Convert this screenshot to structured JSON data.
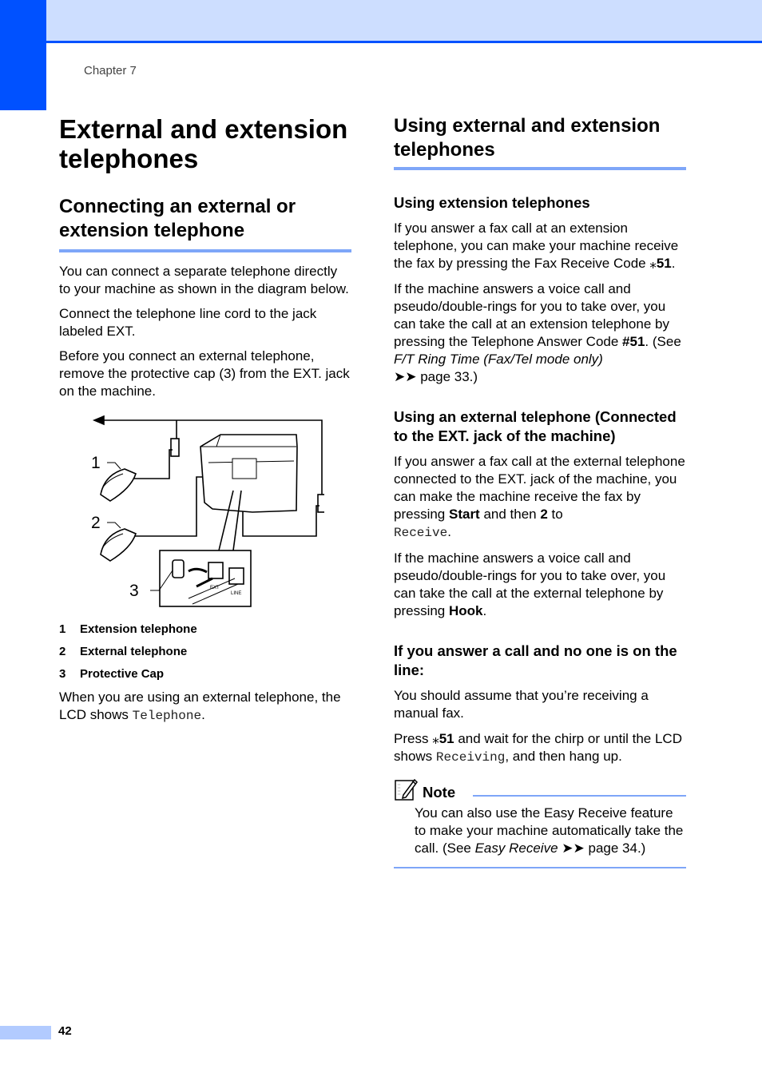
{
  "header": {
    "chapter_label": "Chapter 7"
  },
  "left": {
    "title": "External and extension telephones",
    "section_heading": "Connecting an external or extension telephone",
    "paragraphs": [
      "You can connect a separate telephone directly to your machine as shown in the diagram below.",
      "Connect the telephone line cord to the jack labeled EXT.",
      "Before you connect an external telephone, remove the protective cap (3) from the EXT. jack on the machine."
    ],
    "figure": {
      "callouts": [
        "1",
        "2",
        "3"
      ],
      "jack_labels": [
        "EXT",
        "LINE"
      ]
    },
    "legend": [
      {
        "num": "1",
        "label": "Extension telephone"
      },
      {
        "num": "2",
        "label": "External telephone"
      },
      {
        "num": "3",
        "label": "Protective Cap"
      }
    ],
    "lcd_para": {
      "pre": "When you are using an external telephone, the LCD shows ",
      "mono": "Telephone",
      "post": "."
    }
  },
  "right": {
    "section_heading": "Using external and extension telephones",
    "sub1": {
      "heading": "Using extension telephones",
      "p1": {
        "pre": "If you answer a fax call at an extension telephone, you can make your machine receive the fax by pressing the Fax Receive Code ",
        "star": "⁎",
        "bold": "51",
        "post": "."
      },
      "p2": {
        "pre": "If the machine answers a voice call and pseudo/double-rings for you to take over, you can take the call at an extension telephone by pressing the Telephone Answer Code ",
        "bold": "#51",
        "mid": ". (See ",
        "italic": "F/T Ring Time (Fax/Tel mode only)",
        "arrows": "➤➤",
        "post": " page 33.)"
      }
    },
    "sub2": {
      "heading": "Using an external telephone (Connected to the EXT. jack of the machine)",
      "p1": {
        "pre": "If you answer a fax call at the external telephone connected to the EXT. jack of the machine, you can make the machine receive the fax by pressing ",
        "bold1": "Start",
        "mid": " and then ",
        "bold2": "2",
        "mid2": " to ",
        "mono": "Receive",
        "post": "."
      },
      "p2": {
        "pre": "If the machine answers a voice call and pseudo/double-rings for you to take over, you can take the call at the external telephone by pressing ",
        "bold": "Hook",
        "post": "."
      }
    },
    "sub3": {
      "heading": "If you answer a call and no one is on the line:",
      "p1": "You should assume that you’re receiving a manual fax.",
      "p2": {
        "pre": "Press ",
        "star": "⁎",
        "bold": "51",
        "mid": " and wait for the chirp or until the LCD shows ",
        "mono": "Receiving",
        "post": ", and then hang up."
      }
    },
    "note": {
      "title": "Note",
      "pre": "You can also use the Easy Receive feature to make your machine automatically take the call. (See ",
      "italic": "Easy Receive",
      "arrows": "➤➤",
      "post": " page 34.)"
    }
  },
  "footer": {
    "page_number": "42"
  }
}
